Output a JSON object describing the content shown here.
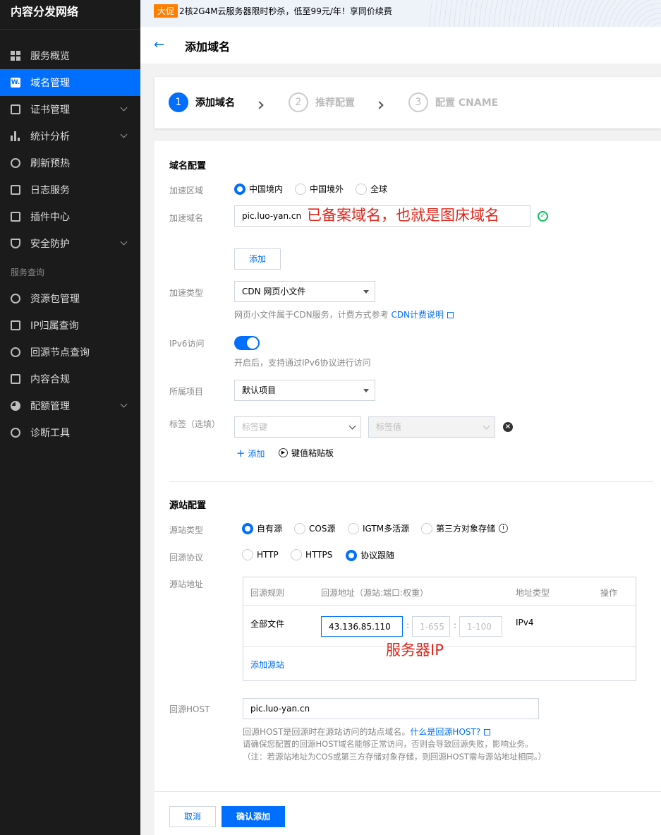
{
  "sidebar": {
    "title": "内容分发网络",
    "items": [
      {
        "label": "服务概览",
        "icon": "grid-icon"
      },
      {
        "label": "域名管理",
        "icon": "domain-icon",
        "active": true
      },
      {
        "label": "证书管理",
        "icon": "certificate-icon",
        "expandable": true
      },
      {
        "label": "统计分析",
        "icon": "bar-chart-icon",
        "expandable": true
      },
      {
        "label": "刷新预热",
        "icon": "refresh-icon"
      },
      {
        "label": "日志服务",
        "icon": "folder-icon"
      },
      {
        "label": "插件中心",
        "icon": "plugin-icon"
      },
      {
        "label": "安全防护",
        "icon": "shield-icon",
        "expandable": true
      }
    ],
    "section_label": "服务查询",
    "items2": [
      {
        "label": "资源包管理",
        "icon": "package-icon"
      },
      {
        "label": "IP归属查询",
        "icon": "ip-icon"
      },
      {
        "label": "回源节点查询",
        "icon": "search-icon"
      },
      {
        "label": "内容合规",
        "icon": "image-icon"
      },
      {
        "label": "配额管理",
        "icon": "pie-icon",
        "expandable": true
      },
      {
        "label": "诊断工具",
        "icon": "diagnose-icon"
      }
    ]
  },
  "promo": {
    "tag": "大促",
    "text": "2核2G4M云服务器限时秒杀，低至99元/年！享同价续费"
  },
  "header": {
    "title": "添加域名",
    "back_icon": "arrow-left-icon"
  },
  "steps": [
    {
      "num": "1",
      "label": "添加域名",
      "active": true
    },
    {
      "num": "2",
      "label": "推荐配置"
    },
    {
      "num": "3",
      "label": "配置 CNAME"
    }
  ],
  "domain_config": {
    "section_title": "域名配置",
    "region_label": "加速区域",
    "regions": [
      "中国境内",
      "中国境外",
      "全球"
    ],
    "domain_label": "加速域名",
    "domain_value": "pic.luo-yan.cn",
    "domain_annotation": "已备案域名，也就是图床域名",
    "add_button": "添加",
    "type_label": "加速类型",
    "type_value": "CDN 网页小文件",
    "type_hint": "网页小文件属于CDN服务，计费方式参考",
    "type_hint_link": "CDN计费说明",
    "ipv6_label": "IPv6访问",
    "ipv6_hint": "开启后，支持通过IPv6协议进行访问",
    "project_label": "所属项目",
    "project_value": "默认项目",
    "tag_label": "标签（选填）",
    "tag_key_placeholder": "标签键",
    "tag_value_placeholder": "标签值",
    "tag_add": "添加",
    "tag_paste": "键值粘贴板"
  },
  "origin_config": {
    "section_title": "源站配置",
    "origin_type_label": "源站类型",
    "origin_types": [
      "自有源",
      "COS源",
      "IGTM多活源",
      "第三方对象存储"
    ],
    "protocol_label": "回源协议",
    "protocols": [
      "HTTP",
      "HTTPS",
      "协议跟随"
    ],
    "address_label": "源站地址",
    "table_headers": [
      "回源规则",
      "回源地址（源站:端口:权重）",
      "地址类型",
      "操作"
    ],
    "rule": "全部文件",
    "ip": "43.136.85.110",
    "port_placeholder": "1-655",
    "weight_placeholder": "1-100",
    "addr_type": "IPv4",
    "ip_annotation": "服务器IP",
    "add_origin": "添加源站",
    "host_label": "回源HOST",
    "host_value": "pic.luo-yan.cn",
    "host_hint1": "回源HOST是回源时在源站访问的站点域名。",
    "host_hint1_link": "什么是回源HOST?",
    "host_hint2": "请确保您配置的回源HOST域名能够正常访问，否则会导致回源失败，影响业务。",
    "host_hint3": "（注：若源站地址为COS或第三方存储对象存储，则回源HOST需与源站地址相同。）"
  },
  "footer": {
    "cancel": "取消",
    "confirm": "确认添加"
  }
}
